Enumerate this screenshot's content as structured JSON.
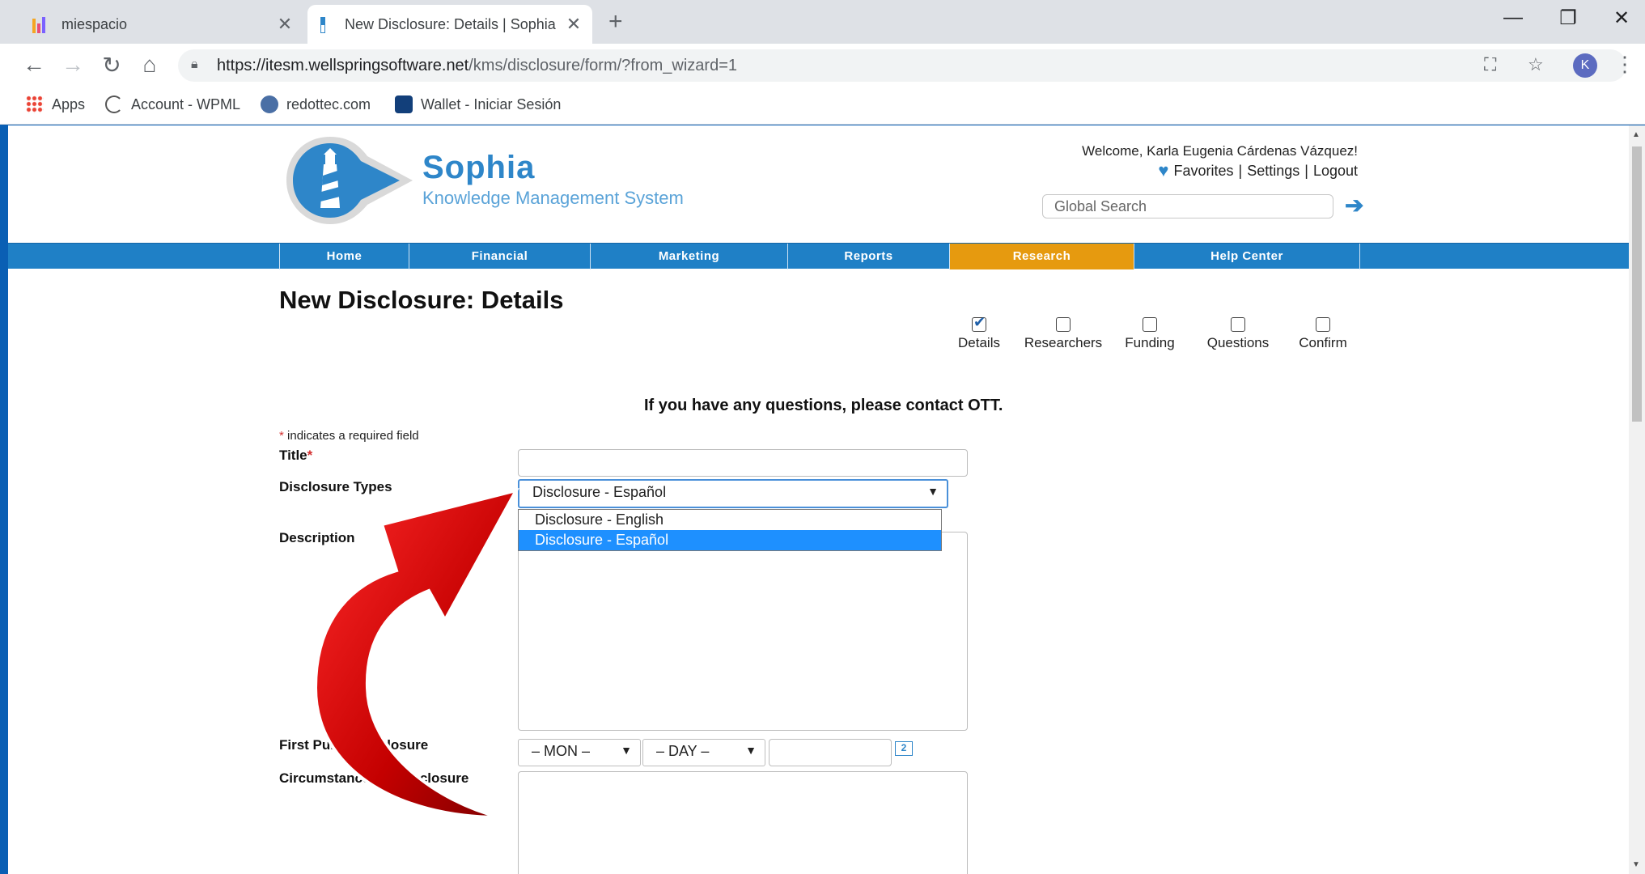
{
  "browser": {
    "tabs": [
      {
        "title": "miespacio",
        "active": false
      },
      {
        "title": "New Disclosure: Details | Sophia",
        "active": true
      }
    ],
    "url_host": "https://itesm.wellspringsoftware.net",
    "url_path": "/kms/disclosure/form/?from_wizard=1",
    "avatar_letter": "K",
    "bookmarks": [
      "Apps",
      "Account - WPML",
      "redottec.com",
      "Wallet - Iniciar Sesión"
    ]
  },
  "header": {
    "brand_name": "Sophia",
    "brand_sub": "Knowledge Management System",
    "welcome": "Welcome, Karla Eugenia Cárdenas Vázquez!",
    "favorites": "Favorites",
    "settings": "Settings",
    "logout": "Logout",
    "separator": "|",
    "search_placeholder": "Global Search"
  },
  "menu": [
    "Home",
    "Financial",
    "Marketing",
    "Reports",
    "Research",
    "Help Center"
  ],
  "menu_active": "Research",
  "page": {
    "title": "New Disclosure: Details",
    "steps": [
      {
        "label": "Details",
        "checked": true
      },
      {
        "label": "Researchers",
        "checked": false
      },
      {
        "label": "Funding",
        "checked": false
      },
      {
        "label": "Questions",
        "checked": false
      },
      {
        "label": "Confirm",
        "checked": false
      }
    ],
    "notice": "If you have any questions, please contact OTT.",
    "required_note": "indicates a required field",
    "required_marker": "*"
  },
  "form": {
    "title_label": "Title",
    "types_label": "Disclosure Types",
    "types_selected": "Disclosure - Español",
    "types_options": [
      "Disclosure - English",
      "Disclosure - Español"
    ],
    "description_label": "Description",
    "first_public_label": "First Public Disclosure",
    "month_placeholder": "– MON –",
    "day_placeholder": "– DAY –",
    "calendar_icon_text": "2",
    "circumstances_label": "Circumstances of Disclosure"
  },
  "colors": {
    "menu_bar": "#1f80c6",
    "menu_active": "#e69a0f",
    "brand_blue": "#2e86c9",
    "dropdown_highlight": "#1e90ff",
    "annotation_arrow": "#c40000"
  }
}
